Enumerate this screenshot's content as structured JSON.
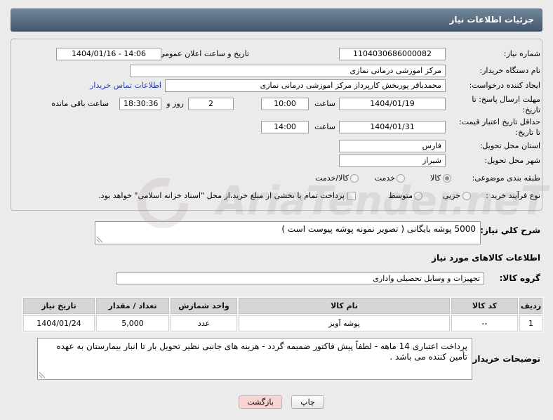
{
  "header": {
    "title": "جزئیات اطلاعات نیاز"
  },
  "watermark": {
    "text": "AriaTender.neT"
  },
  "colors": {
    "page_bg": "#ebebeb",
    "header_top": "#74889c",
    "header_bottom": "#42556a",
    "header_text": "#ffffff",
    "link": "#1f3fb0",
    "table_header_bg": "#d5d5d5",
    "print_button_bg": "#e6e6e6",
    "back_button_bg": "#f7d5d5"
  },
  "form": {
    "need_number": {
      "label": "شماره نیاز:",
      "value": "1104030686000082"
    },
    "announce_datetime": {
      "label": "تاریخ و ساعت اعلان عمومی:",
      "value": "1404/01/16 - 14:06"
    },
    "buyer_org": {
      "label": "نام دستگاه خریدار:",
      "value": "مرکز اموزشی درمانی نمازی"
    },
    "requester": {
      "label": "ایجاد کننده درخواست:",
      "value": "محمدباقر پوربخش کارپرداز مرکز اموزشی درمانی نمازی",
      "contact_link": "اطلاعات تماس خریدار"
    },
    "response_deadline": {
      "label_line1": "مهلت ارسال پاسخ: تا",
      "label_line2": "تاریخ:",
      "date": "1404/01/19",
      "time_label": "ساعت",
      "time": "10:00",
      "days": "2",
      "days_label": "روز و",
      "remaining_time": "18:30:36",
      "remaining_label": "ساعت باقی مانده"
    },
    "price_validity": {
      "label_line1": "حداقل تاریخ اعتبار قیمت:",
      "label_line2": "تا تاریخ:",
      "date": "1404/01/31",
      "time_label": "ساعت",
      "time": "14:00"
    },
    "province": {
      "label": "استان محل تحویل:",
      "value": "فارس"
    },
    "city": {
      "label": "شهر محل تحویل:",
      "value": "شیراز"
    },
    "category": {
      "label": "طبقه بندی موضوعی:",
      "options": [
        {
          "label": "کالا",
          "selected": true
        },
        {
          "label": "خدمت",
          "selected": false
        },
        {
          "label": "کالا/خدمت",
          "selected": false
        }
      ]
    },
    "process_type": {
      "label": "نوع فرآیند خرید :",
      "options": [
        {
          "label": "جزیی",
          "selected": false
        },
        {
          "label": "متوسط",
          "selected": false
        }
      ],
      "treasury_payment": {
        "label": "پرداخت تمام یا بخشی از مبلغ خرید،از محل \"اسناد خزانه اسلامی\" خواهد بود.",
        "checked": false
      }
    }
  },
  "description": {
    "label": "شرح کلي نياز:",
    "text": "5000 پوشه بایگانی ( تصویر نمونه پوشه پیوست است )"
  },
  "items_section": {
    "title": "اطلاعات کالاهای مورد نیاز",
    "group_label": "گروه کالا:",
    "group_value": "تجهیزات و وسایل تحصیلی واداری"
  },
  "items_table": {
    "columns": [
      "ردیف",
      "کد کالا",
      "نام کالا",
      "واحد شمارش",
      "تعداد / مقدار",
      "تاریخ نیاز"
    ],
    "rows": [
      [
        "1",
        "--",
        "پوشه آویز",
        "عدد",
        "5,000",
        "1404/01/24"
      ]
    ]
  },
  "buyer_notes": {
    "label": "توضیحات خریدار:",
    "text": "پرداخت اعتباری 14 ماهه - لطفاً پیش فاکتور ضمیمه گردد - هزینه های جانبی نظیر تحویل بار تا انبار بیمارستان به عهده تأمین کننده می باشد ."
  },
  "buttons": {
    "print": "چاپ",
    "back": "بازگشت"
  }
}
